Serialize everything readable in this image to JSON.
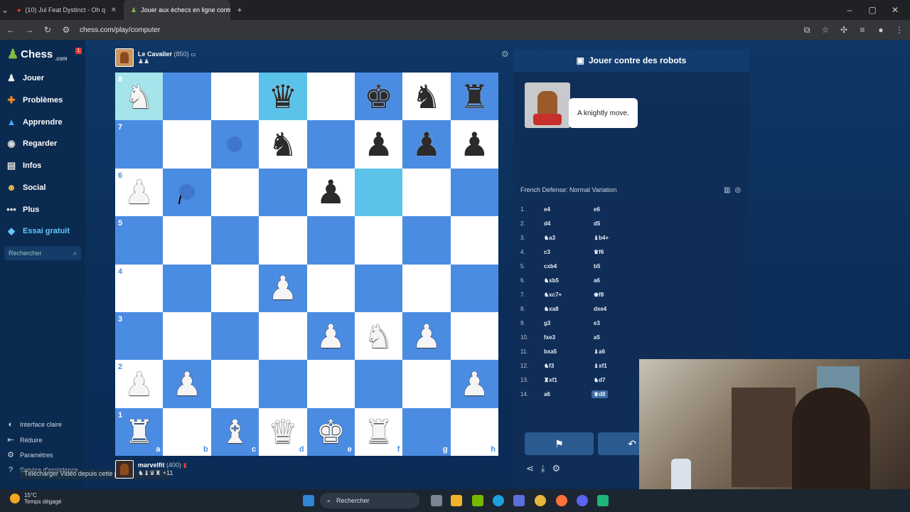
{
  "browser": {
    "tabs": [
      {
        "label": "(10) Jul Feat Dystinct - Oh q"
      },
      {
        "label": "Jouer aux échecs en ligne contr"
      }
    ],
    "url": "chess.com/play/computer"
  },
  "sidebar": {
    "logo": "Chess",
    "logo_suffix": ".com",
    "badge": "1",
    "items": [
      {
        "label": "Jouer",
        "icon": "pawn-icon"
      },
      {
        "label": "Problèmes",
        "icon": "puzzle-icon"
      },
      {
        "label": "Apprendre",
        "icon": "learn-icon"
      },
      {
        "label": "Regarder",
        "icon": "watch-icon"
      },
      {
        "label": "Infos",
        "icon": "news-icon"
      },
      {
        "label": "Social",
        "icon": "social-icon"
      },
      {
        "label": "Plus",
        "icon": "more-icon"
      },
      {
        "label": "Essai gratuit",
        "icon": "diamond-icon"
      }
    ],
    "search_placeholder": "Rechercher",
    "bottom": [
      {
        "label": "Interface claire"
      },
      {
        "label": "Réduire"
      },
      {
        "label": "Paramètres"
      },
      {
        "label": "Service d'assistance"
      }
    ],
    "download_tooltip": "Télécharger Vidéo depuis cette page"
  },
  "opponent": {
    "name": "Le Cavalier",
    "rating": "(850)",
    "captured": "♟♟"
  },
  "player": {
    "name": "marvelfit",
    "rating": "(400)",
    "captured": "♞♝♛♜",
    "advantage": "+11"
  },
  "board": {
    "ranks": [
      "8",
      "7",
      "6",
      "5",
      "4",
      "3",
      "2",
      "1"
    ],
    "files": [
      "a",
      "b",
      "c",
      "d",
      "e",
      "f",
      "g",
      "h"
    ],
    "rows": [
      [
        "wN",
        "",
        "",
        "bQ",
        "",
        "bK",
        "bN",
        "bR"
      ],
      [
        "",
        "",
        "",
        "bN",
        "",
        "bP",
        "bP",
        "bP"
      ],
      [
        "wP",
        "",
        "",
        "",
        "bP",
        "",
        "",
        ""
      ],
      [
        "",
        "",
        "",
        "",
        "",
        "",
        "",
        ""
      ],
      [
        "",
        "",
        "",
        "wP",
        "",
        "",
        "",
        ""
      ],
      [
        "",
        "",
        "",
        "",
        "wP",
        "wN",
        "wP",
        ""
      ],
      [
        "wP",
        "wP",
        "",
        "",
        "",
        "",
        "",
        "wP"
      ],
      [
        "wR",
        "",
        "wB",
        "wQ",
        "wK",
        "wR",
        "",
        ""
      ]
    ],
    "highlights": [
      {
        "sq": "a8",
        "kind": "hl2"
      },
      {
        "sq": "d8",
        "kind": "hl"
      },
      {
        "sq": "f6",
        "kind": "hl"
      }
    ],
    "dots": [
      "c7",
      "b6"
    ]
  },
  "panel": {
    "title": "Jouer contre des robots",
    "bot_message": "A knightly move.",
    "opening": "French Defense: Normal Variation",
    "moves": [
      {
        "n": "1.",
        "w": "e4",
        "b": "e6"
      },
      {
        "n": "2.",
        "w": "d4",
        "b": "d5"
      },
      {
        "n": "3.",
        "w": "♞a3",
        "b": "♝b4+"
      },
      {
        "n": "4.",
        "w": "c3",
        "b": "♛f6"
      },
      {
        "n": "5.",
        "w": "cxb4",
        "b": "b5"
      },
      {
        "n": "6.",
        "w": "♞xb5",
        "b": "a6"
      },
      {
        "n": "7.",
        "w": "♞xc7+",
        "b": "♚f8"
      },
      {
        "n": "8.",
        "w": "♞xa8",
        "b": "dxe4"
      },
      {
        "n": "9.",
        "w": "g3",
        "b": "e3"
      },
      {
        "n": "10.",
        "w": "fxe3",
        "b": "a5"
      },
      {
        "n": "11.",
        "w": "bxa5",
        "b": "♝a6"
      },
      {
        "n": "12.",
        "w": "♞f3",
        "b": "♝xf1"
      },
      {
        "n": "13.",
        "w": "♜xf1",
        "b": "♞d7"
      },
      {
        "n": "14.",
        "w": "a6",
        "b": "♛d8"
      }
    ]
  },
  "taskbar": {
    "temperature": "15°C",
    "weather": "Temps dégagé",
    "search": "Rechercher"
  }
}
